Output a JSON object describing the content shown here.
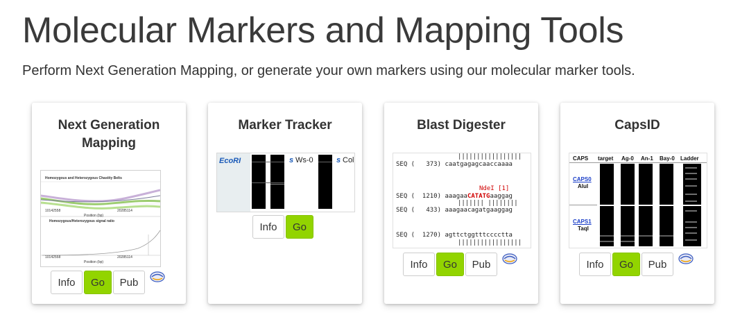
{
  "header": {
    "title": "Molecular Markers and Mapping Tools",
    "subtitle": "Perform Next Generation Mapping, or generate your own markers using our molecular marker tools."
  },
  "colors": {
    "go_button": "#92d400",
    "link_blue": "#1a3ec8",
    "restriction_red": "#d00000"
  },
  "cards": [
    {
      "title_line1": "Next Generation",
      "title_line2": "Mapping",
      "thumbnail": {
        "plot1_title": "Homozygous and Heterozygous Chastity Belts",
        "plot2_title": "Homozygous/Heterozygous signal ratio",
        "tick_left": "10142558",
        "tick_right": "20285114",
        "xlabel": "Position (bp)"
      },
      "buttons": {
        "info": "Info",
        "go": "Go",
        "pub": "Pub"
      },
      "pub_icon": "publication-icon"
    },
    {
      "title": "Marker Tracker",
      "thumbnail": {
        "enzyme": "EcoRI",
        "lane_s1": "s",
        "lane1": "Ws-0",
        "lane_s2": "s",
        "lane2": "Col"
      },
      "buttons": {
        "info": "Info",
        "go": "Go"
      }
    },
    {
      "title": "Blast Digester",
      "thumbnail": {
        "row1": "SEQ (   373) caatgagagcaaccaaaa",
        "enzyme_label": "NdeI [1]",
        "row2_prefix": "SEQ (  1210) aaagaa",
        "row2_site": "CATATG",
        "row2_suffix": "aaggag",
        "row3": "SEQ (   433) aaagaacagatgaaggag",
        "row4": "SEQ (  1270) agttctggtttcccctta"
      },
      "buttons": {
        "info": "Info",
        "go": "Go",
        "pub": "Pub"
      },
      "pub_icon": "publication-icon"
    },
    {
      "title": "CapsID",
      "thumbnail": {
        "headers": [
          "CAPS",
          "target",
          "Ag-0",
          "An-1",
          "Bay-0",
          "Ladder"
        ],
        "row1_link": "CAPS0",
        "row1_enzyme": "AluI",
        "row2_link": "CAPS1",
        "row2_enzyme": "TaqI"
      },
      "buttons": {
        "info": "Info",
        "go": "Go",
        "pub": "Pub"
      },
      "pub_icon": "publication-icon"
    }
  ]
}
